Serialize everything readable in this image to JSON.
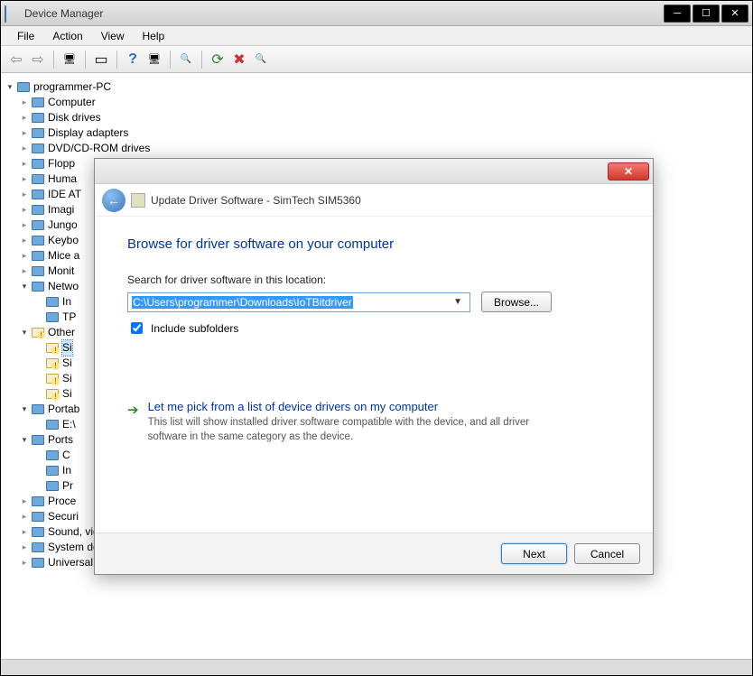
{
  "window": {
    "title": "Device Manager"
  },
  "menu": [
    "File",
    "Action",
    "View",
    "Help"
  ],
  "tree": {
    "root": "programmer-PC",
    "nodes": [
      {
        "label": "Computer",
        "expanded": false
      },
      {
        "label": "Disk drives",
        "expanded": false
      },
      {
        "label": "Display adapters",
        "expanded": false
      },
      {
        "label": "DVD/CD-ROM drives",
        "expanded": false
      },
      {
        "label": "Flopp",
        "expanded": false
      },
      {
        "label": "Huma",
        "expanded": false
      },
      {
        "label": "IDE AT",
        "expanded": false
      },
      {
        "label": "Imagi",
        "expanded": false
      },
      {
        "label": "Jungo",
        "expanded": false
      },
      {
        "label": "Keybo",
        "expanded": false
      },
      {
        "label": "Mice a",
        "expanded": false
      },
      {
        "label": "Monit",
        "expanded": false
      },
      {
        "label": "Netwo",
        "expanded": true,
        "children": [
          {
            "label": "In"
          },
          {
            "label": "TP"
          }
        ]
      },
      {
        "label": "Other",
        "expanded": true,
        "warn": true,
        "children": [
          {
            "label": "Si",
            "warn": true,
            "selected": true
          },
          {
            "label": "Si",
            "warn": true
          },
          {
            "label": "Si",
            "warn": true
          },
          {
            "label": "Si",
            "warn": true
          }
        ]
      },
      {
        "label": "Portab",
        "expanded": true,
        "children": [
          {
            "label": "E:\\"
          }
        ]
      },
      {
        "label": "Ports",
        "expanded": true,
        "children": [
          {
            "label": "C"
          },
          {
            "label": "In"
          },
          {
            "label": "Pr"
          }
        ]
      },
      {
        "label": "Proce",
        "expanded": false
      },
      {
        "label": "Securi",
        "expanded": false
      },
      {
        "label": "Sound, video and game controllers",
        "expanded": false
      },
      {
        "label": "System devices",
        "expanded": false
      },
      {
        "label": "Universal Serial Bus controllers",
        "expanded": false
      }
    ]
  },
  "dialog": {
    "header": "Update Driver Software - SimTech SIM5360",
    "heading": "Browse for driver software on your computer",
    "search_label": "Search for driver software in this location:",
    "path": "C:\\Users\\programmer\\Downloads\\IoTBitdriver",
    "browse": "Browse...",
    "include_subfolders": "Include subfolders",
    "include_subfolders_checked": true,
    "pick_title": "Let me pick from a list of device drivers on my computer",
    "pick_desc": "This list will show installed driver software compatible with the device, and all driver software in the same category as the device.",
    "next": "Next",
    "cancel": "Cancel"
  }
}
